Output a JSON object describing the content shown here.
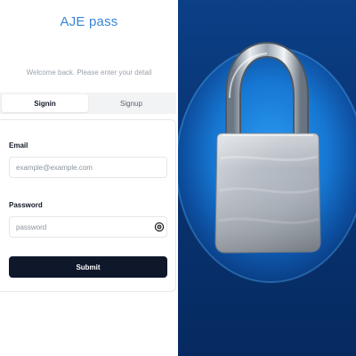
{
  "app": {
    "title": "AJE pass",
    "subtitle": "Welcome back. Please enter your detail"
  },
  "tabs": [
    {
      "label": "Signin",
      "active": true
    },
    {
      "label": "Signup",
      "active": false
    }
  ],
  "form": {
    "email_label": "Email",
    "email_placeholder": "example@example.com",
    "email_value": "",
    "password_label": "Password",
    "password_placeholder": "password",
    "password_value": "",
    "submit_label": "Submit"
  },
  "hero": {
    "image": "padlock-illustration",
    "colors": {
      "background": "#08326f",
      "glow": "#1e88e5",
      "submit_button": "#0f172a",
      "title": "#3a86d6"
    }
  },
  "icons": {
    "password_toggle": "eye-icon"
  }
}
